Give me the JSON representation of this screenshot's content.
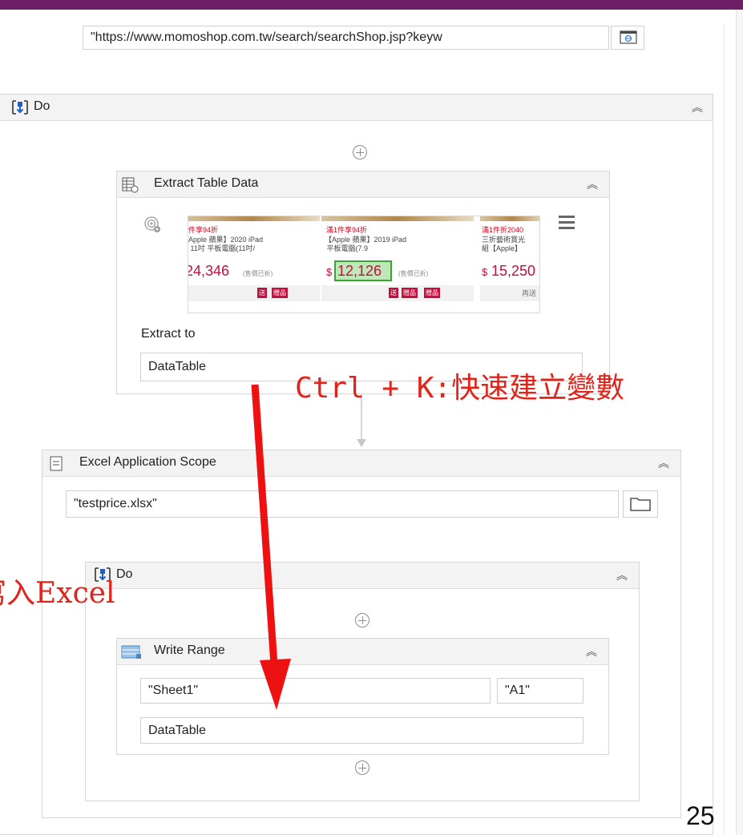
{
  "url_field": {
    "value": "\"https://www.momoshop.com.tw/search/searchShop.jsp?keyw"
  },
  "outer_do": {
    "title": "Do"
  },
  "extract_table": {
    "title": "Extract Table Data",
    "extract_to_label": "Extract to",
    "extract_to_value": "DataTable",
    "preview": {
      "products": [
        {
          "promo": "件享94折",
          "desc": "Apple 蘋果】2020 iPad\n 11吋 平板電腦(11吋/",
          "price": "24,346",
          "note": "(售價已折)",
          "badges": [
            "送",
            "贈品"
          ]
        },
        {
          "promo": "滿1件享94折",
          "desc": "【Apple 蘋果】2019 iPad\n 平板電腦(7.9",
          "price": "12,126",
          "price_prefix": "$",
          "note": "(售價已折)",
          "badges": [
            "送",
            "贈品",
            "贈品"
          ]
        },
        {
          "promo": "滿1件折2040",
          "desc": "三折藝術賞光\n組【Apple】",
          "price": "15,250",
          "price_prefix": "$",
          "note": "再送"
        }
      ]
    }
  },
  "excel_scope": {
    "title": "Excel Application Scope",
    "file_value": "\"testprice.xlsx\""
  },
  "inner_do": {
    "title": "Do"
  },
  "write_range": {
    "title": "Write Range",
    "sheet_value": "\"Sheet1\"",
    "cell_value": "\"A1\"",
    "data_value": "DataTable"
  },
  "annotations": {
    "shortcut": "Ctrl + K:快速建立變數",
    "write_excel": "寫入Excel"
  },
  "page_number": "25",
  "colors": {
    "top_bar": "#6b1e66",
    "annotation": "#e2231a",
    "arrow": "#ee1111"
  }
}
